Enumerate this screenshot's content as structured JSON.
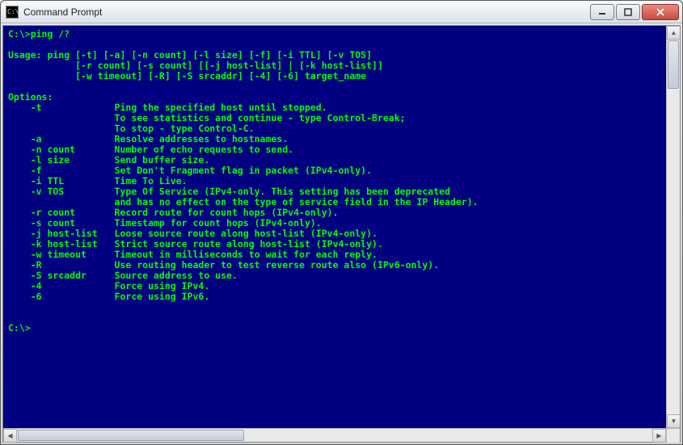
{
  "window": {
    "title": "Command Prompt"
  },
  "console": {
    "prompt1": "C:\\>ping /?",
    "blank": "",
    "usage_l1": "Usage: ping [-t] [-a] [-n count] [-l size] [-f] [-i TTL] [-v TOS]",
    "usage_l2": "            [-r count] [-s count] [[-j host-list] | [-k host-list]]",
    "usage_l3": "            [-w timeout] [-R] [-S srcaddr] [-4] [-6] target_name",
    "options_hdr": "Options:",
    "opt_t_l1": "    -t             Ping the specified host until stopped.",
    "opt_t_l2": "                   To see statistics and continue - type Control-Break;",
    "opt_t_l3": "                   To stop - type Control-C.",
    "opt_a": "    -a             Resolve addresses to hostnames.",
    "opt_n": "    -n count       Number of echo requests to send.",
    "opt_l": "    -l size        Send buffer size.",
    "opt_f": "    -f             Set Don't Fragment flag in packet (IPv4-only).",
    "opt_i": "    -i TTL         Time To Live.",
    "opt_v_l1": "    -v TOS         Type Of Service (IPv4-only. This setting has been deprecated",
    "opt_v_l2": "                   and has no effect on the type of service field in the IP Header).",
    "opt_r": "    -r count       Record route for count hops (IPv4-only).",
    "opt_s": "    -s count       Timestamp for count hops (IPv4-only).",
    "opt_j": "    -j host-list   Loose source route along host-list (IPv4-only).",
    "opt_k": "    -k host-list   Strict source route along host-list (IPv4-only).",
    "opt_w": "    -w timeout     Timeout in milliseconds to wait for each reply.",
    "opt_R": "    -R             Use routing header to test reverse route also (IPv6-only).",
    "opt_S": "    -S srcaddr     Source address to use.",
    "opt_4": "    -4             Force using IPv4.",
    "opt_6": "    -6             Force using IPv6.",
    "prompt2": "C:\\>"
  }
}
